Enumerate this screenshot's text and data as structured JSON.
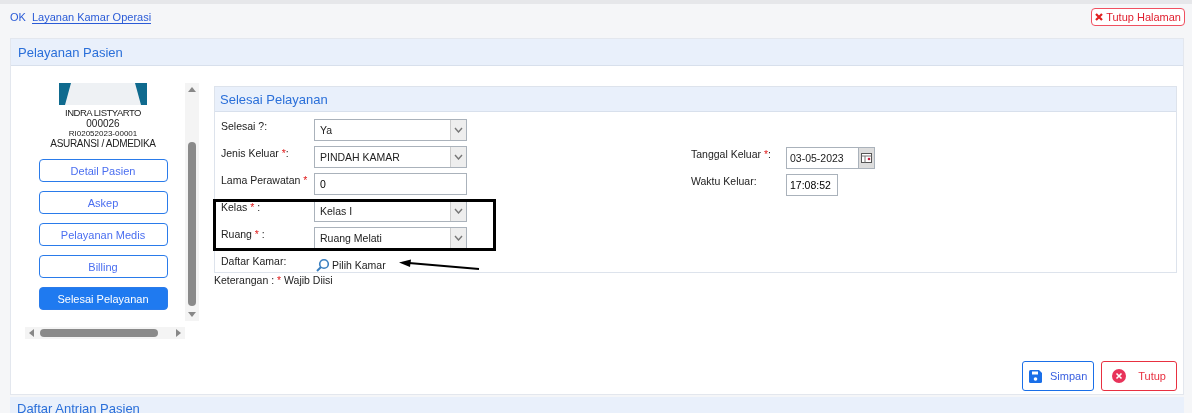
{
  "topbar": {
    "prefix": "OK",
    "breadcrumb": "Layanan Kamar Operasi",
    "close_button": "Tutup Halaman"
  },
  "panel": {
    "title": "Pelayanan Pasien"
  },
  "patient": {
    "name": "INDRA LISTYARTO",
    "number": "000026",
    "registration": "RI02052023-00001",
    "payer": "ASURANSI / ADMEDIKA"
  },
  "menu": [
    {
      "label": "Detail Pasien",
      "selected": false
    },
    {
      "label": "Askep",
      "selected": false
    },
    {
      "label": "Pelayanan Medis",
      "selected": false
    },
    {
      "label": "Billing",
      "selected": false
    },
    {
      "label": "Selesai Pelayanan",
      "selected": true
    }
  ],
  "form": {
    "title": "Selesai Pelayanan",
    "left_fields": [
      {
        "label": "Selesai ?:",
        "required": false,
        "kind": "select",
        "value": "Ya",
        "highlighted": false
      },
      {
        "label": "Jenis Keluar ",
        "required": true,
        "suffix": ":",
        "kind": "select",
        "value": "PINDAH KAMAR",
        "highlighted": false
      },
      {
        "label": "Lama Perawatan ",
        "required": true,
        "kind": "input",
        "value": "0",
        "highlighted": false
      },
      {
        "label": "Kelas ",
        "required": true,
        "suffix": " :",
        "kind": "select",
        "value": "Kelas I",
        "highlighted": true
      },
      {
        "label": "Ruang ",
        "required": true,
        "suffix": " :",
        "kind": "select",
        "value": "Ruang Melati",
        "highlighted": true
      },
      {
        "label": "Daftar Kamar:",
        "required": false,
        "kind": "link",
        "value": "Pilih Kamar",
        "highlighted": false
      }
    ],
    "right_fields": [
      {
        "label": "Tanggal Keluar ",
        "required": true,
        "suffix": ":",
        "kind": "date",
        "value": "03-05-2023"
      },
      {
        "label": "Waktu Keluar:",
        "required": false,
        "kind": "time",
        "value": "17:08:52"
      }
    ],
    "note_label": "Keterangan : ",
    "note_mark": "*",
    "note_text": " Wajib Diisi"
  },
  "buttons": [
    {
      "label": "Simpan",
      "kind": "save"
    },
    {
      "label": "Tutup",
      "kind": "close"
    }
  ],
  "next_panel": {
    "title": "Daftar Antrian Pasien"
  }
}
